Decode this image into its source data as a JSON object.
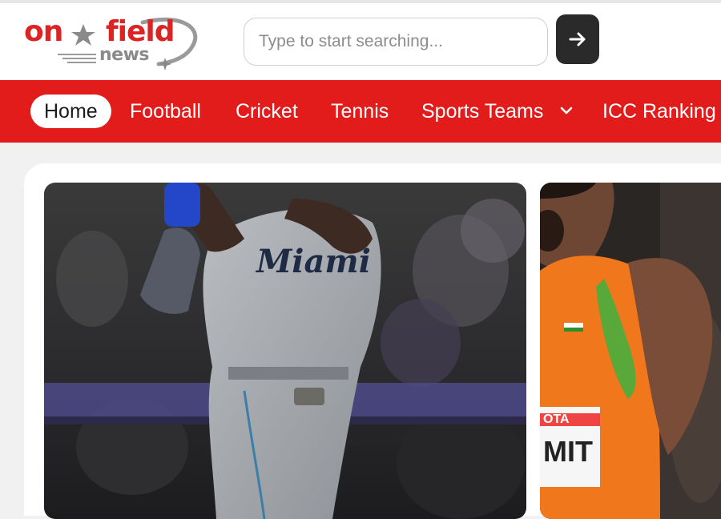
{
  "logo": {
    "word_on": "on",
    "word_field": "field",
    "word_news": "news",
    "colors": {
      "red": "#dd2424",
      "grey": "#8a8a8a"
    }
  },
  "search": {
    "placeholder": "Type to start searching...",
    "value": "",
    "submit_icon": "arrow-right-icon"
  },
  "nav": {
    "background": "#e21b1b",
    "items": [
      {
        "label": "Home",
        "active": true
      },
      {
        "label": "Football",
        "active": false
      },
      {
        "label": "Cricket",
        "active": false
      },
      {
        "label": "Tennis",
        "active": false
      },
      {
        "label": "Sports Teams",
        "active": false,
        "has_dropdown": true,
        "icon": "chevron-down-icon"
      },
      {
        "label": "ICC Ranking",
        "active": false
      }
    ]
  },
  "cards": [
    {
      "image": "baseball-player-photo",
      "jersey_text": "Miami"
    },
    {
      "image": "javelin-athlete-photo",
      "bib_text": "SUMIT"
    }
  ]
}
